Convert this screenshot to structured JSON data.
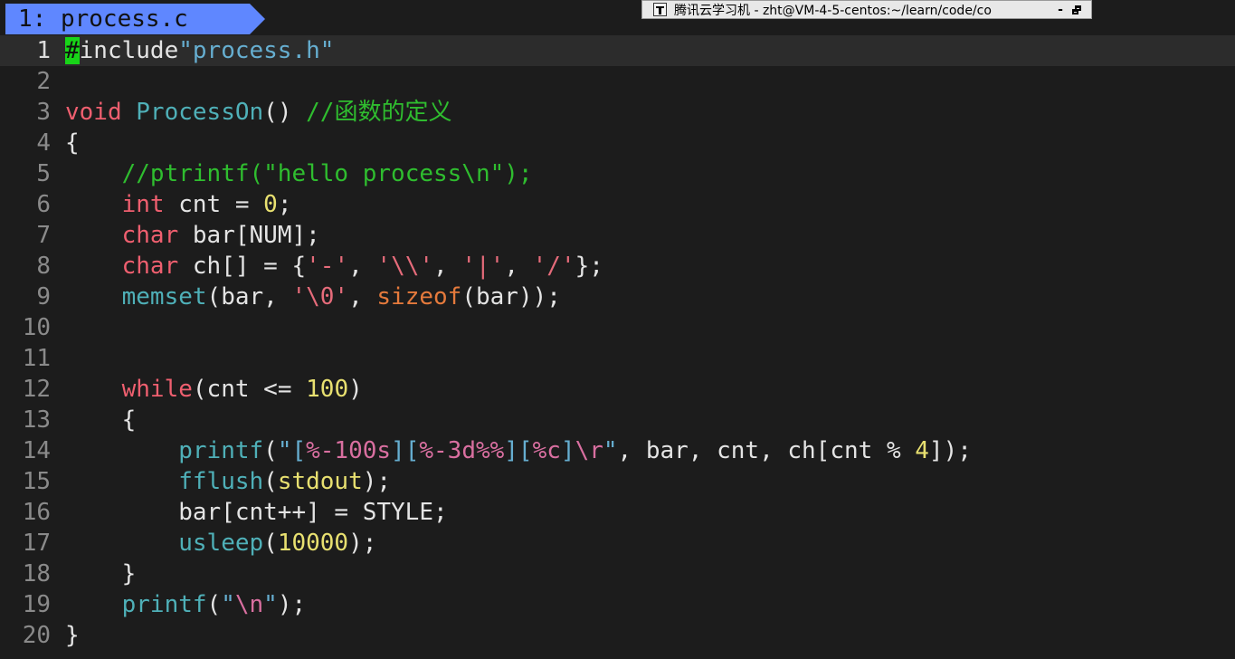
{
  "tabline": {
    "tab_label": "1: process.c"
  },
  "window_chip": {
    "title": "腾讯云学习机 - zht@VM-4-5-centos:~/learn/code/co",
    "minimize_label": "-"
  },
  "editor": {
    "current_line": 1,
    "lines": [
      {
        "n": "1",
        "segments": [
          {
            "t": "#",
            "c": "cursor"
          },
          {
            "t": "include",
            "c": ""
          },
          {
            "t": "\"process.h\"",
            "c": "str"
          }
        ]
      },
      {
        "n": "2",
        "segments": []
      },
      {
        "n": "3",
        "segments": [
          {
            "t": "void",
            "c": "ty"
          },
          {
            "t": " ",
            "c": ""
          },
          {
            "t": "ProcessOn",
            "c": "fn"
          },
          {
            "t": "() ",
            "c": ""
          },
          {
            "t": "//函数的定义",
            "c": "cmt"
          }
        ]
      },
      {
        "n": "4",
        "segments": [
          {
            "t": "{",
            "c": ""
          }
        ]
      },
      {
        "n": "5",
        "segments": [
          {
            "t": "    ",
            "c": ""
          },
          {
            "t": "//ptrintf(\"hello process\\n\");",
            "c": "cmt"
          }
        ]
      },
      {
        "n": "6",
        "segments": [
          {
            "t": "    ",
            "c": ""
          },
          {
            "t": "int",
            "c": "ty"
          },
          {
            "t": " cnt = ",
            "c": ""
          },
          {
            "t": "0",
            "c": "num"
          },
          {
            "t": ";",
            "c": ""
          }
        ]
      },
      {
        "n": "7",
        "segments": [
          {
            "t": "    ",
            "c": ""
          },
          {
            "t": "char",
            "c": "ty"
          },
          {
            "t": " bar[NUM];",
            "c": ""
          }
        ]
      },
      {
        "n": "8",
        "segments": [
          {
            "t": "    ",
            "c": ""
          },
          {
            "t": "char",
            "c": "ty"
          },
          {
            "t": " ch[] = {",
            "c": ""
          },
          {
            "t": "'-'",
            "c": "chr"
          },
          {
            "t": ", ",
            "c": ""
          },
          {
            "t": "'\\\\'",
            "c": "chr"
          },
          {
            "t": ", ",
            "c": ""
          },
          {
            "t": "'|'",
            "c": "chr"
          },
          {
            "t": ", ",
            "c": ""
          },
          {
            "t": "'/'",
            "c": "chr"
          },
          {
            "t": "};",
            "c": ""
          }
        ]
      },
      {
        "n": "9",
        "segments": [
          {
            "t": "    ",
            "c": ""
          },
          {
            "t": "memset",
            "c": "fn"
          },
          {
            "t": "(bar, ",
            "c": ""
          },
          {
            "t": "'\\0'",
            "c": "chr"
          },
          {
            "t": ", ",
            "c": ""
          },
          {
            "t": "sizeof",
            "c": "szf"
          },
          {
            "t": "(bar));",
            "c": ""
          }
        ]
      },
      {
        "n": "10",
        "segments": []
      },
      {
        "n": "11",
        "segments": []
      },
      {
        "n": "12",
        "segments": [
          {
            "t": "    ",
            "c": ""
          },
          {
            "t": "while",
            "c": "kw"
          },
          {
            "t": "(cnt <= ",
            "c": ""
          },
          {
            "t": "100",
            "c": "num"
          },
          {
            "t": ")",
            "c": ""
          }
        ]
      },
      {
        "n": "13",
        "segments": [
          {
            "t": "    {",
            "c": ""
          }
        ]
      },
      {
        "n": "14",
        "segments": [
          {
            "t": "        ",
            "c": ""
          },
          {
            "t": "printf",
            "c": "fn"
          },
          {
            "t": "(",
            "c": ""
          },
          {
            "t": "\"[",
            "c": "str"
          },
          {
            "t": "%-100s",
            "c": "pct"
          },
          {
            "t": "][",
            "c": "str"
          },
          {
            "t": "%-3d%%",
            "c": "pct"
          },
          {
            "t": "][",
            "c": "str"
          },
          {
            "t": "%c",
            "c": "pct"
          },
          {
            "t": "]",
            "c": "str"
          },
          {
            "t": "\\r",
            "c": "pct"
          },
          {
            "t": "\"",
            "c": "str"
          },
          {
            "t": ", bar, cnt, ch[cnt % ",
            "c": ""
          },
          {
            "t": "4",
            "c": "num"
          },
          {
            "t": "]);",
            "c": ""
          }
        ]
      },
      {
        "n": "15",
        "segments": [
          {
            "t": "        ",
            "c": ""
          },
          {
            "t": "fflush",
            "c": "fn"
          },
          {
            "t": "(",
            "c": ""
          },
          {
            "t": "stdout",
            "c": "num"
          },
          {
            "t": ");",
            "c": ""
          }
        ]
      },
      {
        "n": "16",
        "segments": [
          {
            "t": "        bar[cnt++] = STYLE;",
            "c": ""
          }
        ]
      },
      {
        "n": "17",
        "segments": [
          {
            "t": "        ",
            "c": ""
          },
          {
            "t": "usleep",
            "c": "fn"
          },
          {
            "t": "(",
            "c": ""
          },
          {
            "t": "10000",
            "c": "num"
          },
          {
            "t": ");",
            "c": ""
          }
        ]
      },
      {
        "n": "18",
        "segments": [
          {
            "t": "    }",
            "c": ""
          }
        ]
      },
      {
        "n": "19",
        "segments": [
          {
            "t": "    ",
            "c": ""
          },
          {
            "t": "printf",
            "c": "fn"
          },
          {
            "t": "(",
            "c": ""
          },
          {
            "t": "\"",
            "c": "str"
          },
          {
            "t": "\\n",
            "c": "pct"
          },
          {
            "t": "\"",
            "c": "str"
          },
          {
            "t": ");",
            "c": ""
          }
        ]
      },
      {
        "n": "20",
        "segments": [
          {
            "t": "}",
            "c": ""
          }
        ]
      }
    ]
  }
}
